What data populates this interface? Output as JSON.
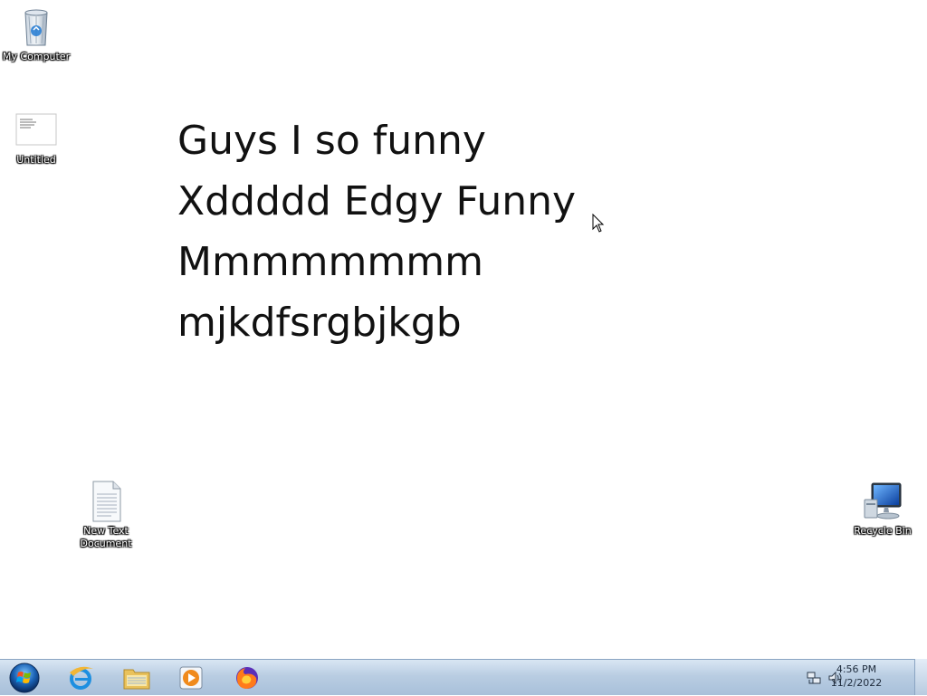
{
  "desktop": {
    "icons": {
      "my_computer": {
        "label": "My Computer",
        "icon": "recycle-bin-icon"
      },
      "untitled": {
        "label": "Untitled",
        "icon": "document-thumbnail-icon"
      },
      "new_text_document": {
        "label": "New Text Document",
        "icon": "text-file-icon"
      },
      "recycle_bin": {
        "label": "Recycle Bin",
        "icon": "computer-monitor-icon"
      }
    },
    "wallpaper_text": [
      "Guys I so funny",
      "Xddddd Edgy Funny",
      "Mmmmmmmm",
      "mjkdfsrgbjkgb"
    ]
  },
  "taskbar": {
    "start_icon": "windows-orb-icon",
    "pinned": [
      {
        "name": "internet-explorer",
        "icon": "internet-explorer-icon"
      },
      {
        "name": "file-explorer",
        "icon": "folder-icon"
      },
      {
        "name": "media-player",
        "icon": "media-player-icon"
      },
      {
        "name": "firefox",
        "icon": "firefox-icon"
      }
    ],
    "tray": {
      "network_icon": "network-icon",
      "volume_icon": "speaker-icon"
    },
    "clock": {
      "time": "4:56 PM",
      "date": "11/2/2022"
    }
  },
  "colors": {
    "taskbar_top": "#d9e6f3",
    "taskbar_bottom": "#a8c0da",
    "desktop_bg": "#ffffff",
    "text": "#111111"
  }
}
